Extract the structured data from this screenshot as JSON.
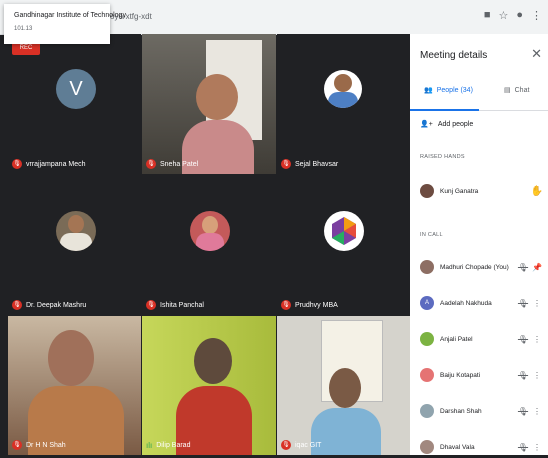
{
  "browser": {
    "url": "oyo-xtfg-xdt",
    "site_popup": {
      "title": "Gandhinagar Institute of Technology",
      "subtitle": "101.13"
    },
    "recording_badge": "REC"
  },
  "tiles": [
    {
      "name": "vrrajjampana Mech",
      "mic": "off",
      "avatar_letter": "V"
    },
    {
      "name": "Sneha Patel",
      "mic": "off"
    },
    {
      "name": "Sejal Bhavsar",
      "mic": "off"
    },
    {
      "name": "Dr. Deepak Mashru",
      "mic": "off"
    },
    {
      "name": "Ishita Panchal",
      "mic": "off"
    },
    {
      "name": "Prudhvy MBA",
      "mic": "off"
    },
    {
      "name": "Dr H N Shah",
      "mic": "off"
    },
    {
      "name": "Dilip Barad",
      "mic": "on"
    },
    {
      "name": "iqac GIT",
      "mic": "off"
    }
  ],
  "panel": {
    "title": "Meeting details",
    "tabs": [
      {
        "label": "People (34)",
        "active": true
      },
      {
        "label": "Chat",
        "active": false
      }
    ],
    "add_people": "Add people",
    "raised_hands_header": "RAISED HANDS",
    "raised_hands": [
      {
        "name": "Kunj Ganatra"
      }
    ],
    "in_call_header": "IN CALL",
    "in_call": [
      {
        "name": "Madhuri Chopade (You)",
        "avatar_color": "#8d6e63",
        "pin": true
      },
      {
        "name": "Aadelah Nakhuda",
        "avatar_letter": "A",
        "avatar_color": "#5c6bc0"
      },
      {
        "name": "Anjali Patel",
        "avatar_color": "#7cb342"
      },
      {
        "name": "Baiju Kotapati",
        "avatar_color": "#e57373"
      },
      {
        "name": "Darshan Shah",
        "avatar_color": "#90a4ae"
      },
      {
        "name": "Dhaval Vala",
        "avatar_color": "#a1887f"
      }
    ]
  }
}
